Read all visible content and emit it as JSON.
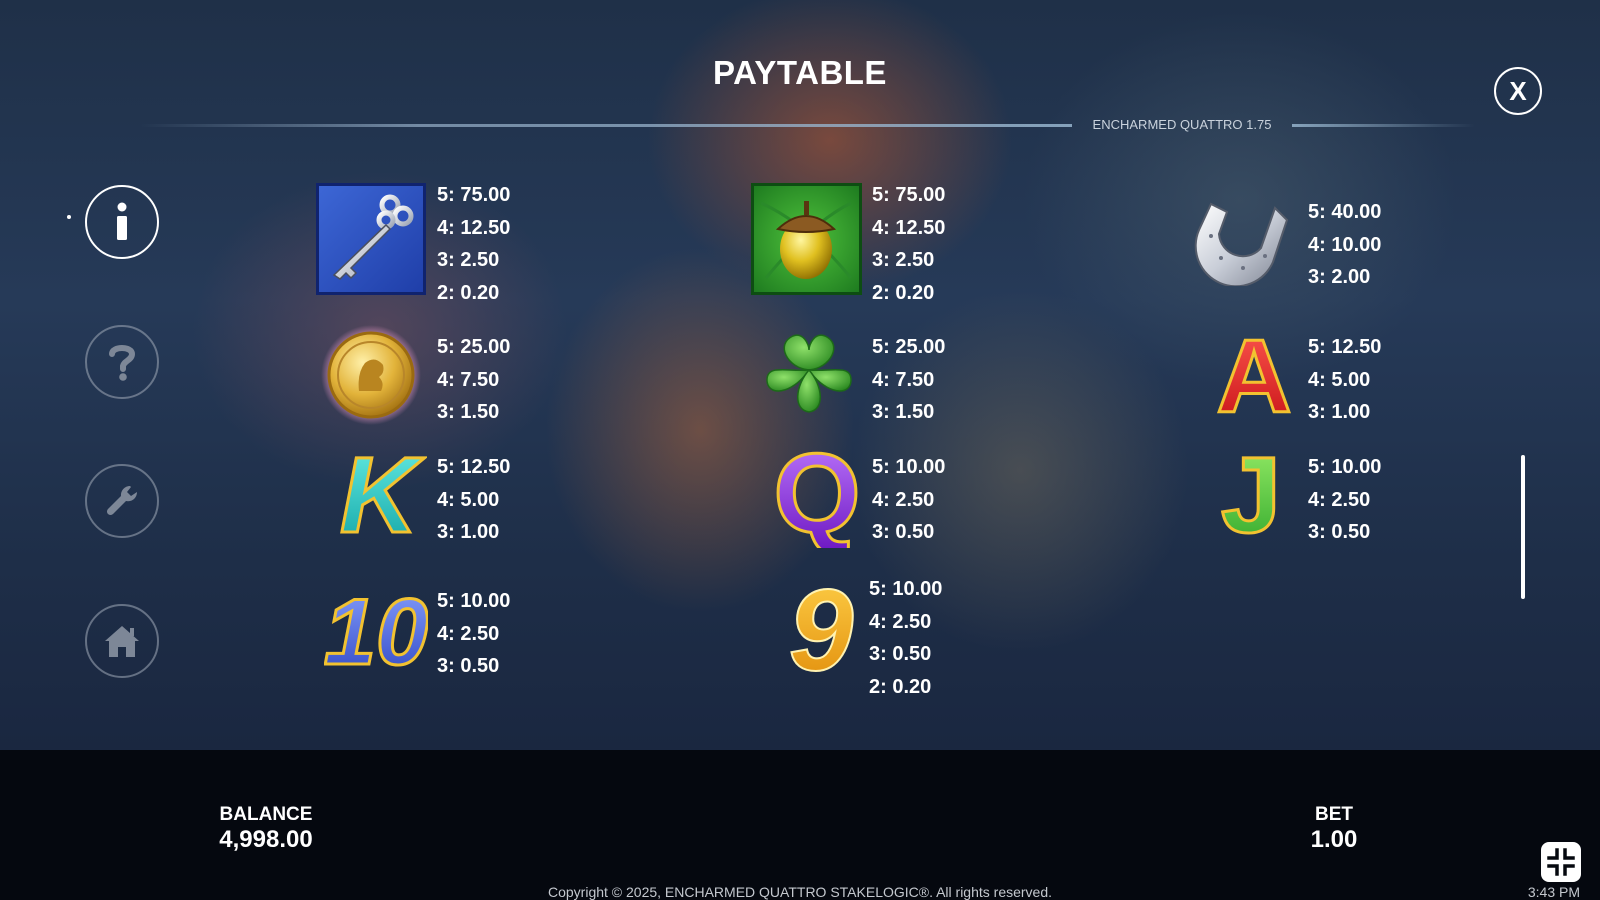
{
  "header": {
    "title": "PAYTABLE",
    "version": "ENCHARMED QUATTRO 1.75",
    "close_label": "X"
  },
  "sidebar": [
    {
      "name": "info",
      "icon": "info-icon",
      "active": true
    },
    {
      "name": "help",
      "icon": "question-icon",
      "active": false
    },
    {
      "name": "settings",
      "icon": "wrench-icon",
      "active": false
    },
    {
      "name": "home",
      "icon": "home-icon",
      "active": false
    }
  ],
  "paytable": {
    "key": [
      "5: 75.00",
      "4: 12.50",
      "3: 2.50",
      "2: 0.20"
    ],
    "acorn": [
      "5: 75.00",
      "4: 12.50",
      "3: 2.50",
      "2: 0.20"
    ],
    "horseshoe": [
      "5: 40.00",
      "4: 10.00",
      "3: 2.00"
    ],
    "coin": [
      "5: 25.00",
      "4: 7.50",
      "3: 1.50"
    ],
    "clover": [
      "5: 25.00",
      "4: 7.50",
      "3: 1.50"
    ],
    "ace": [
      "5: 12.50",
      "4: 5.00",
      "3: 1.00"
    ],
    "king": [
      "5: 12.50",
      "4: 5.00",
      "3: 1.00"
    ],
    "queen": [
      "5: 10.00",
      "4: 2.50",
      "3: 0.50"
    ],
    "jack": [
      "5: 10.00",
      "4: 2.50",
      "3: 0.50"
    ],
    "ten": [
      "5: 10.00",
      "4: 2.50",
      "3: 0.50"
    ],
    "nine": [
      "5: 10.00",
      "4: 2.50",
      "3: 0.50",
      "2: 0.20"
    ]
  },
  "symbols": {
    "ace_glyph": "A",
    "king_glyph": "K",
    "queen_glyph": "Q",
    "jack_glyph": "J",
    "ten_glyph": "10",
    "nine_glyph": "9"
  },
  "footer": {
    "balance_label": "BALANCE",
    "balance_value": "4,998.00",
    "bet_label": "BET",
    "bet_value": "1.00",
    "copyright": "Copyright © 2025, ENCHARMED QUATTRO STAKELOGIC®. All rights reserved.",
    "clock": "3:43 PM"
  },
  "colors": {
    "accent": "#ffffff",
    "background": "#05080f"
  }
}
